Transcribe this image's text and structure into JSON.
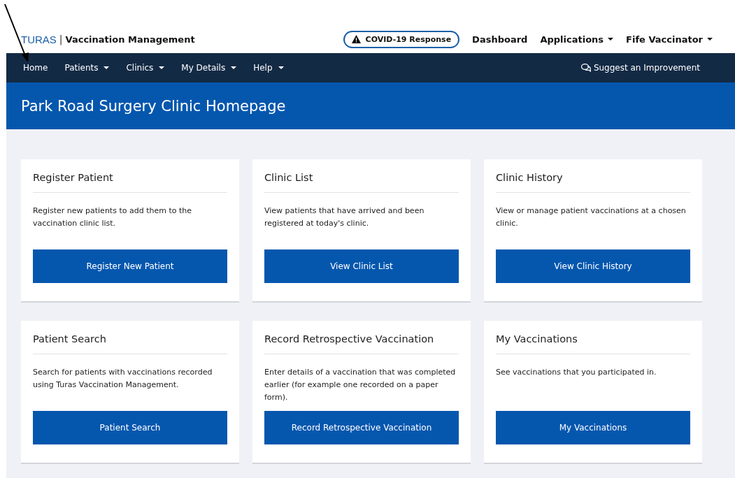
{
  "header": {
    "brand": "TURAS",
    "separator": "|",
    "product": "Vaccination Management",
    "alert_button": "COVID-19 Response",
    "links": [
      {
        "label": "Dashboard",
        "dropdown": false
      },
      {
        "label": "Applications",
        "dropdown": true
      },
      {
        "label": "Fife Vaccinator",
        "dropdown": true
      }
    ]
  },
  "nav": {
    "items": [
      {
        "label": "Home",
        "dropdown": false
      },
      {
        "label": "Patients",
        "dropdown": true
      },
      {
        "label": "Clinics",
        "dropdown": true
      },
      {
        "label": "My Details",
        "dropdown": true
      },
      {
        "label": "Help",
        "dropdown": true
      }
    ],
    "suggest": "Suggest an Improvement"
  },
  "page_title": "Park Road Surgery Clinic Homepage",
  "cards": [
    {
      "title": "Register Patient",
      "description": "Register new patients to add them to the vaccination clinic list.",
      "button": "Register New Patient"
    },
    {
      "title": "Clinic List",
      "description": "View patients that have arrived and been registered at today's clinic.",
      "button": "View Clinic List"
    },
    {
      "title": "Clinic History",
      "description": "View or manage patient vaccinations at a chosen clinic.",
      "button": "View Clinic History"
    },
    {
      "title": "Patient Search",
      "description": "Search for patients with vaccinations recorded using Turas Vaccination Management.",
      "button": "Patient Search"
    },
    {
      "title": "Record Retrospective Vaccination",
      "description": "Enter details of a vaccination that was completed earlier (for example one recorded on a paper form).",
      "button": "Record Retrospective Vaccination"
    },
    {
      "title": "My Vaccinations",
      "description": "See vaccinations that you participated in.",
      "button": "My Vaccinations"
    }
  ]
}
